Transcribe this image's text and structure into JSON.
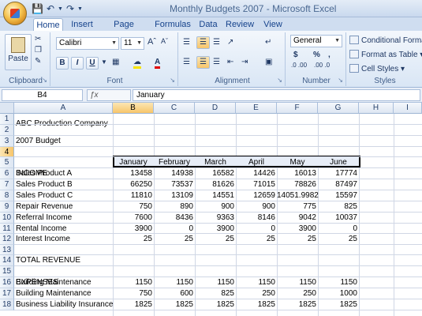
{
  "window": {
    "title": "Monthly Budgets 2007 - Microsoft Excel"
  },
  "qat": {
    "save_icon": "save-icon",
    "undo_icon": "undo-icon",
    "redo_icon": "redo-icon"
  },
  "tabs": [
    "Home",
    "Insert",
    "Page Layout",
    "Formulas",
    "Data",
    "Review",
    "View"
  ],
  "ribbon": {
    "clipboard": {
      "label": "Clipboard",
      "paste": "Paste"
    },
    "font": {
      "label": "Font",
      "font_name": "Calibri",
      "font_size": "11",
      "bold": "B",
      "italic": "I",
      "underline": "U"
    },
    "alignment": {
      "label": "Alignment"
    },
    "number": {
      "label": "Number",
      "format": "General",
      "currency": "$",
      "percent": "%",
      "comma": ",",
      "inc_decimal": ".0 .00",
      "dec_decimal": ".00 .0"
    },
    "styles": {
      "label": "Styles",
      "conditional": "Conditional Formatti",
      "format_table": "Format as Table",
      "cell_styles": "Cell Styles"
    }
  },
  "formula_bar": {
    "name_box": "B4",
    "fx": "fx",
    "content": "January"
  },
  "columns": [
    "A",
    "B",
    "C",
    "D",
    "E",
    "F",
    "G",
    "H",
    "I"
  ],
  "rows": [
    "1",
    "2",
    "3",
    "4",
    "5",
    "6",
    "7",
    "8",
    "9",
    "10",
    "11",
    "12",
    "13",
    "14",
    "15",
    "16",
    "17",
    "18"
  ],
  "sheet": {
    "a1": "ABC Production Company",
    "a2": "2007 Budget",
    "months": [
      "January",
      "February",
      "March",
      "April",
      "May",
      "June"
    ],
    "a5": "INCOME",
    "income": [
      {
        "label": "Sales Product A",
        "values": [
          "13458",
          "14938",
          "16582",
          "14426",
          "16013",
          "17774"
        ]
      },
      {
        "label": "Sales Product B",
        "values": [
          "66250",
          "73537",
          "81626",
          "71015",
          "78826",
          "87497"
        ]
      },
      {
        "label": "Sales Product C",
        "values": [
          "11810",
          "13109",
          "14551",
          "12659",
          "14051.9982",
          "15597"
        ]
      },
      {
        "label": "Repair Revenue",
        "values": [
          "750",
          "890",
          "900",
          "900",
          "775",
          "825"
        ]
      },
      {
        "label": "Referral Income",
        "values": [
          "7600",
          "8436",
          "9363",
          "8146",
          "9042",
          "10037"
        ]
      },
      {
        "label": "Rental Income",
        "values": [
          "3900",
          "0",
          "3900",
          "0",
          "3900",
          "0"
        ]
      },
      {
        "label": "Interest Income",
        "values": [
          "25",
          "25",
          "25",
          "25",
          "25",
          "25"
        ]
      }
    ],
    "a13": "TOTAL REVENUE",
    "a15": "EXPENSES",
    "expenses": [
      {
        "label": "Building Maintenance",
        "values": [
          "1150",
          "1150",
          "1150",
          "1150",
          "1150",
          "1150"
        ]
      },
      {
        "label": "Building Maintenance",
        "values": [
          "750",
          "600",
          "825",
          "250",
          "250",
          "1000"
        ]
      },
      {
        "label": "Business Liability Insurance",
        "values": [
          "1825",
          "1825",
          "1825",
          "1825",
          "1825",
          "1825"
        ]
      }
    ]
  }
}
